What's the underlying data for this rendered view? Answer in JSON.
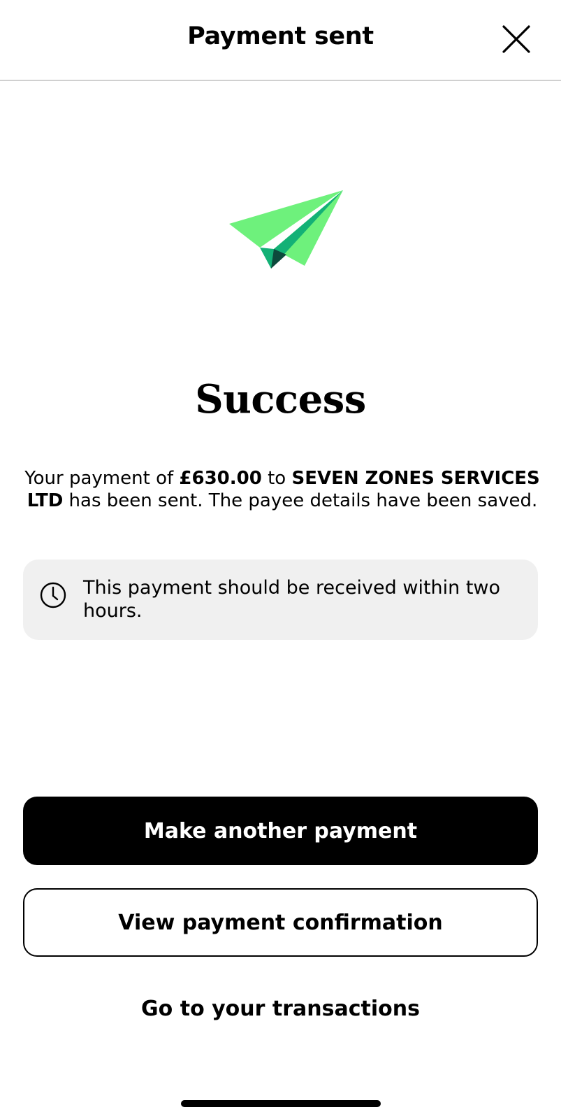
{
  "header": {
    "title": "Payment sent",
    "close_icon": "close-icon"
  },
  "illustration": {
    "icon": "paper-plane-icon",
    "colors": {
      "light": "#6ef17c",
      "dark": "#13b176",
      "shadow": "#0d4a3c"
    }
  },
  "main": {
    "title": "Success",
    "message": {
      "prefix": "Your payment of ",
      "amount": "£630.00",
      "middle": " to ",
      "payee": "SEVEN ZONES SERVICES LTD",
      "suffix": " has been sent. The payee details have been saved."
    },
    "info": {
      "icon": "clock-icon",
      "text": "This payment should be received within two hours."
    }
  },
  "actions": {
    "primary_label": "Make another payment",
    "secondary_label": "View payment confirmation",
    "link_label": "Go to your transactions"
  },
  "colors": {
    "background": "#ffffff",
    "info_box": "#f0f0f0",
    "primary_button": "#000000",
    "divider": "#d0d0d0"
  }
}
